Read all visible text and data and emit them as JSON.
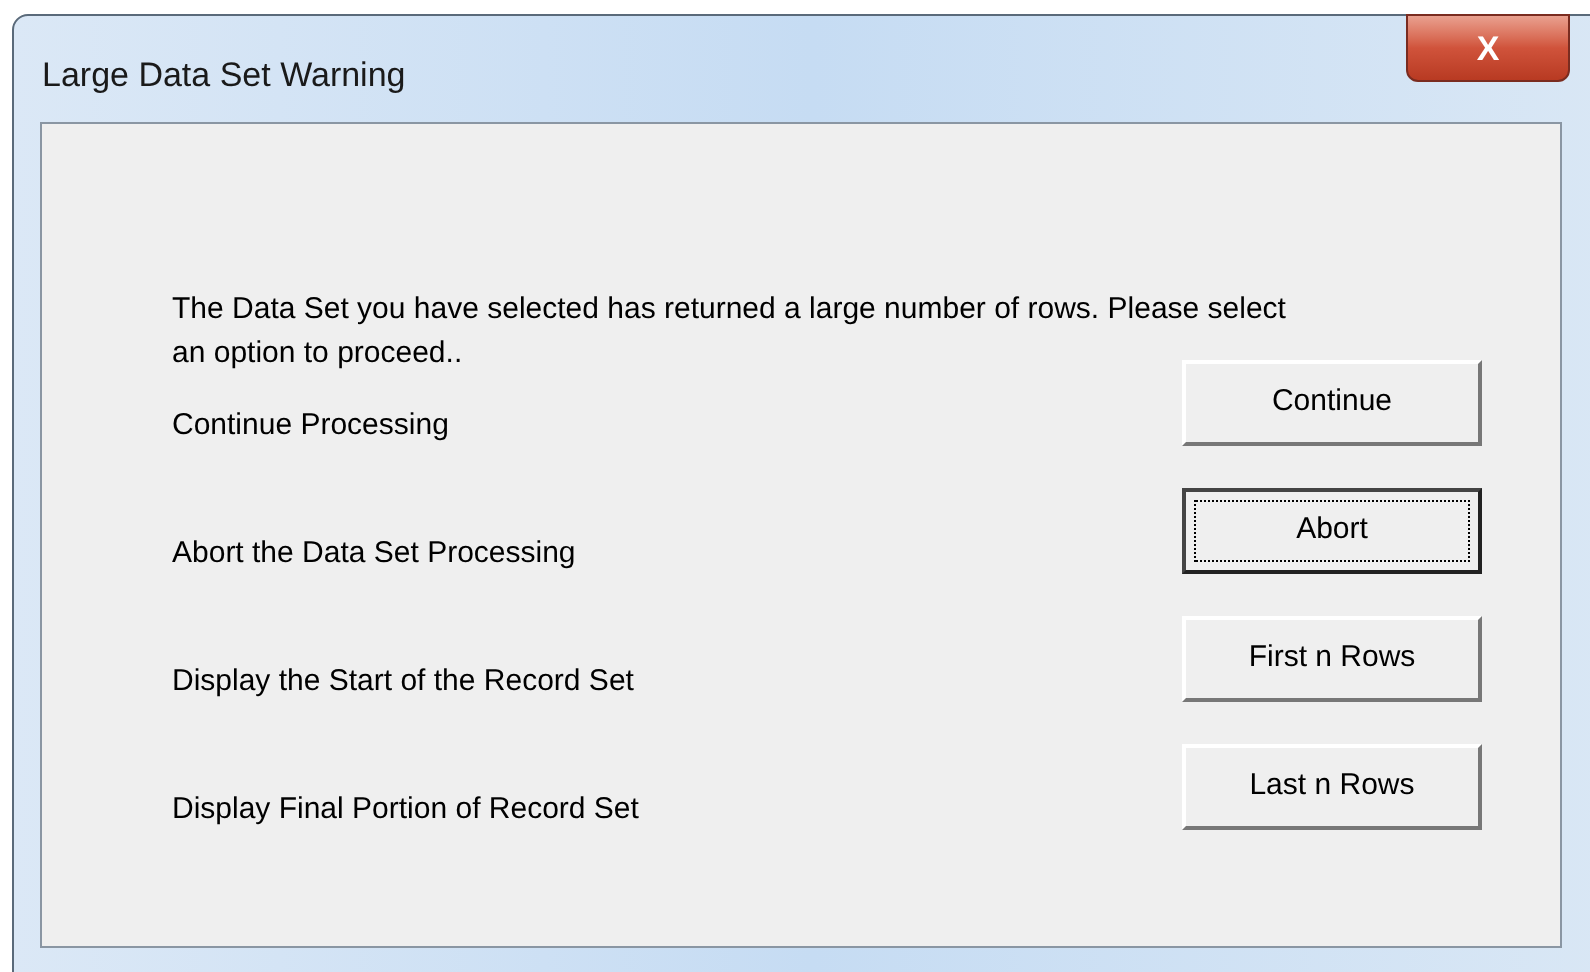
{
  "window": {
    "title": "Large Data Set Warning",
    "close_label": "X"
  },
  "message": "The Data Set you have selected has returned a large number of rows. Please select an option to proceed..",
  "options": [
    {
      "label": "Continue Processing",
      "button": "Continue",
      "focused": false
    },
    {
      "label": "Abort the Data Set Processing",
      "button": "Abort",
      "focused": true
    },
    {
      "label": "Display the Start of the Record Set",
      "button": "First n Rows",
      "focused": false
    },
    {
      "label": "Display Final Portion of Record Set",
      "button": "Last n Rows",
      "focused": false
    }
  ]
}
